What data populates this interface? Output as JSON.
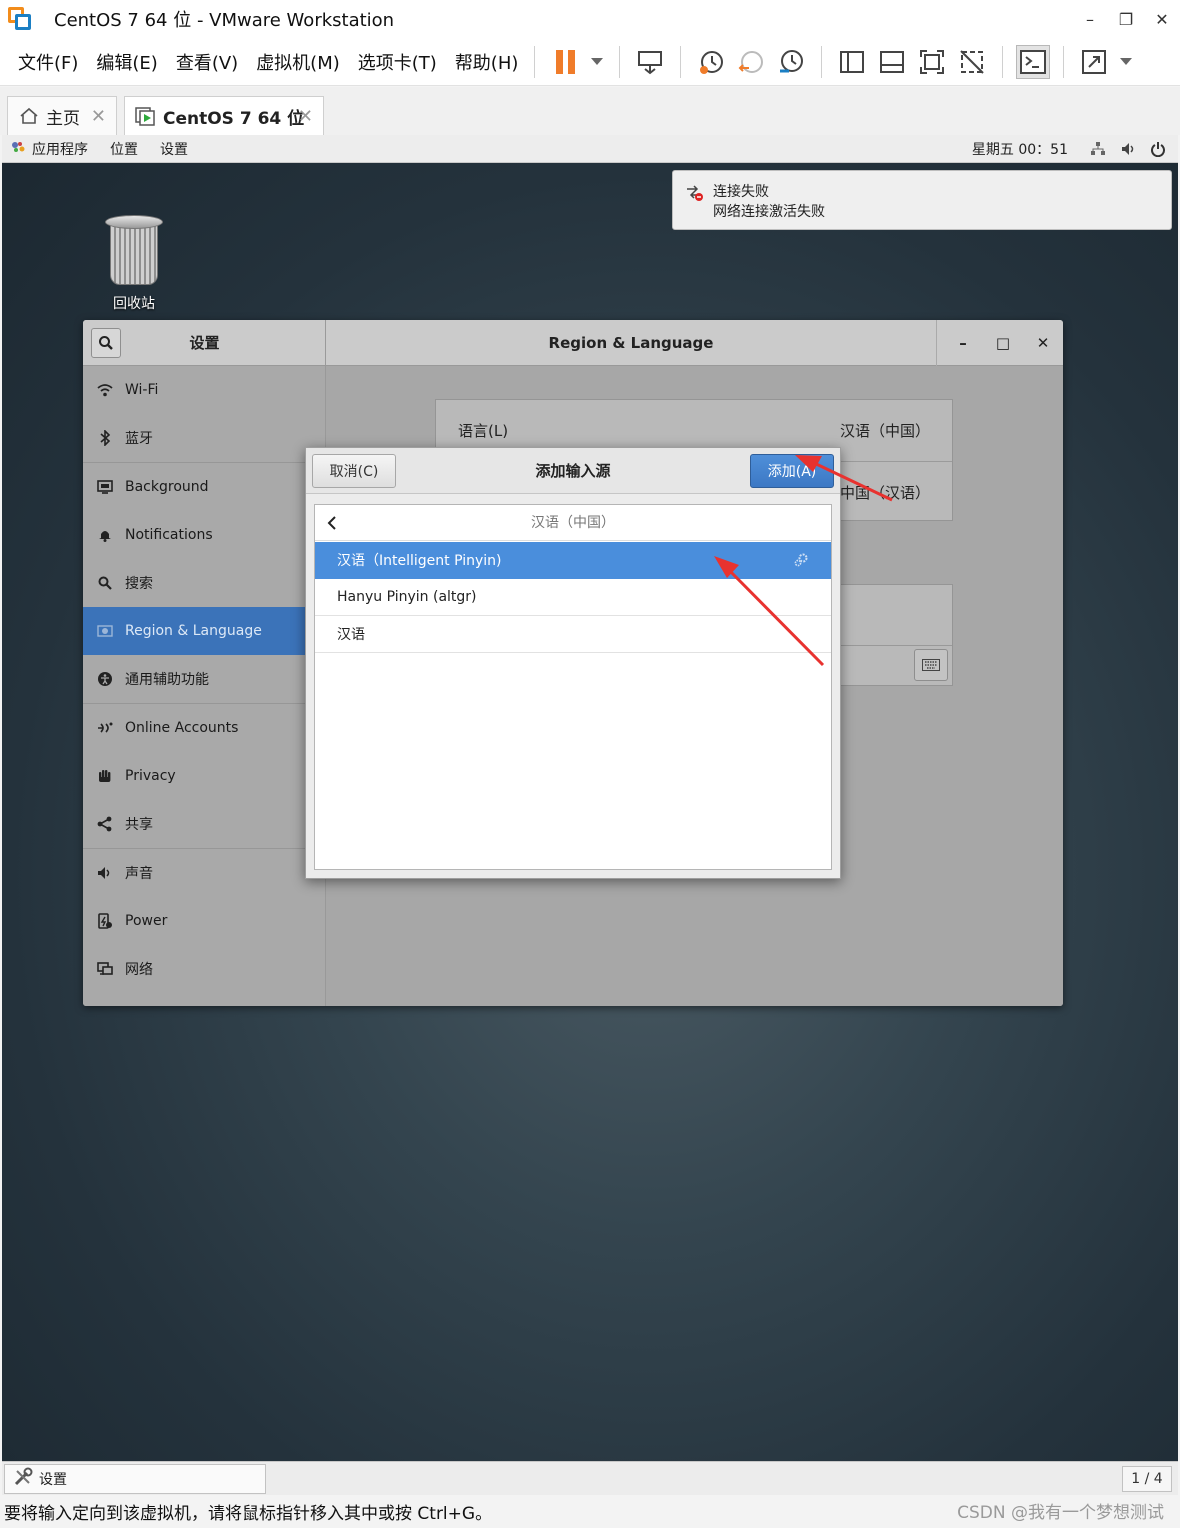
{
  "window": {
    "title": "CentOS 7 64 位 - VMware Workstation",
    "minimize": "–",
    "restore": "❐",
    "close": "✕"
  },
  "menu": [
    "文件(F)",
    "编辑(E)",
    "查看(V)",
    "虚拟机(M)",
    "选项卡(T)",
    "帮助(H)"
  ],
  "tabs": {
    "home_label": "主页",
    "vm_label": "CentOS 7 64 位",
    "close_glyph": "✕"
  },
  "gnome_topbar": {
    "apps": "应用程序",
    "places": "位置",
    "settings": "设置",
    "clock": "星期五 00：51"
  },
  "desktop": {
    "trash_label": "回收站"
  },
  "notification": {
    "title": "连接失败",
    "body": "网络连接激活失败"
  },
  "settings_window": {
    "sidebar_title": "设置",
    "panel_title": "Region & Language",
    "min": "–",
    "max": "□",
    "close": "✕",
    "sidebar_items": [
      {
        "label": "Wi-Fi",
        "icon": "wifi-icon"
      },
      {
        "label": "蓝牙",
        "icon": "bluetooth-icon"
      },
      {
        "label": "Background",
        "icon": "background-icon"
      },
      {
        "label": "Notifications",
        "icon": "bell-icon"
      },
      {
        "label": "搜索",
        "icon": "search-icon"
      },
      {
        "label": "Region & Language",
        "icon": "region-icon",
        "selected": true
      },
      {
        "label": "通用辅助功能",
        "icon": "accessibility-icon"
      },
      {
        "label": "Online Accounts",
        "icon": "online-accounts-icon"
      },
      {
        "label": "Privacy",
        "icon": "hand-icon"
      },
      {
        "label": "共享",
        "icon": "share-icon"
      },
      {
        "label": "声音",
        "icon": "speaker-icon"
      },
      {
        "label": "Power",
        "icon": "power-icon"
      },
      {
        "label": "网络",
        "icon": "network-icon"
      }
    ],
    "language_label": "语言(L)",
    "language_value": "汉语（中国）",
    "formats_value": "中国（汉语）"
  },
  "dialog": {
    "title": "添加输入源",
    "cancel": "取消(C)",
    "add": "添加(A)",
    "back_title": "汉语（中国）",
    "back_glyph": "‹",
    "items": [
      {
        "label": "汉语（Intelligent Pinyin)",
        "selected": true,
        "has_settings": true
      },
      {
        "label": "Hanyu Pinyin (altgr)",
        "selected": false
      },
      {
        "label": "汉语",
        "selected": false
      }
    ]
  },
  "taskbar": {
    "item_label": "设置",
    "pager": "1 / 4"
  },
  "statusbar": {
    "text": "要将输入定向到该虚拟机，请将鼠标指针移入其中或按 Ctrl+G。",
    "watermark": "CSDN @我有一个梦想测试"
  },
  "colors": {
    "selection_blue": "#4a8edc",
    "sidebar_selected": "#3b73b9",
    "annotation_red": "#e8322f",
    "pause_orange": "#f07c2a"
  }
}
